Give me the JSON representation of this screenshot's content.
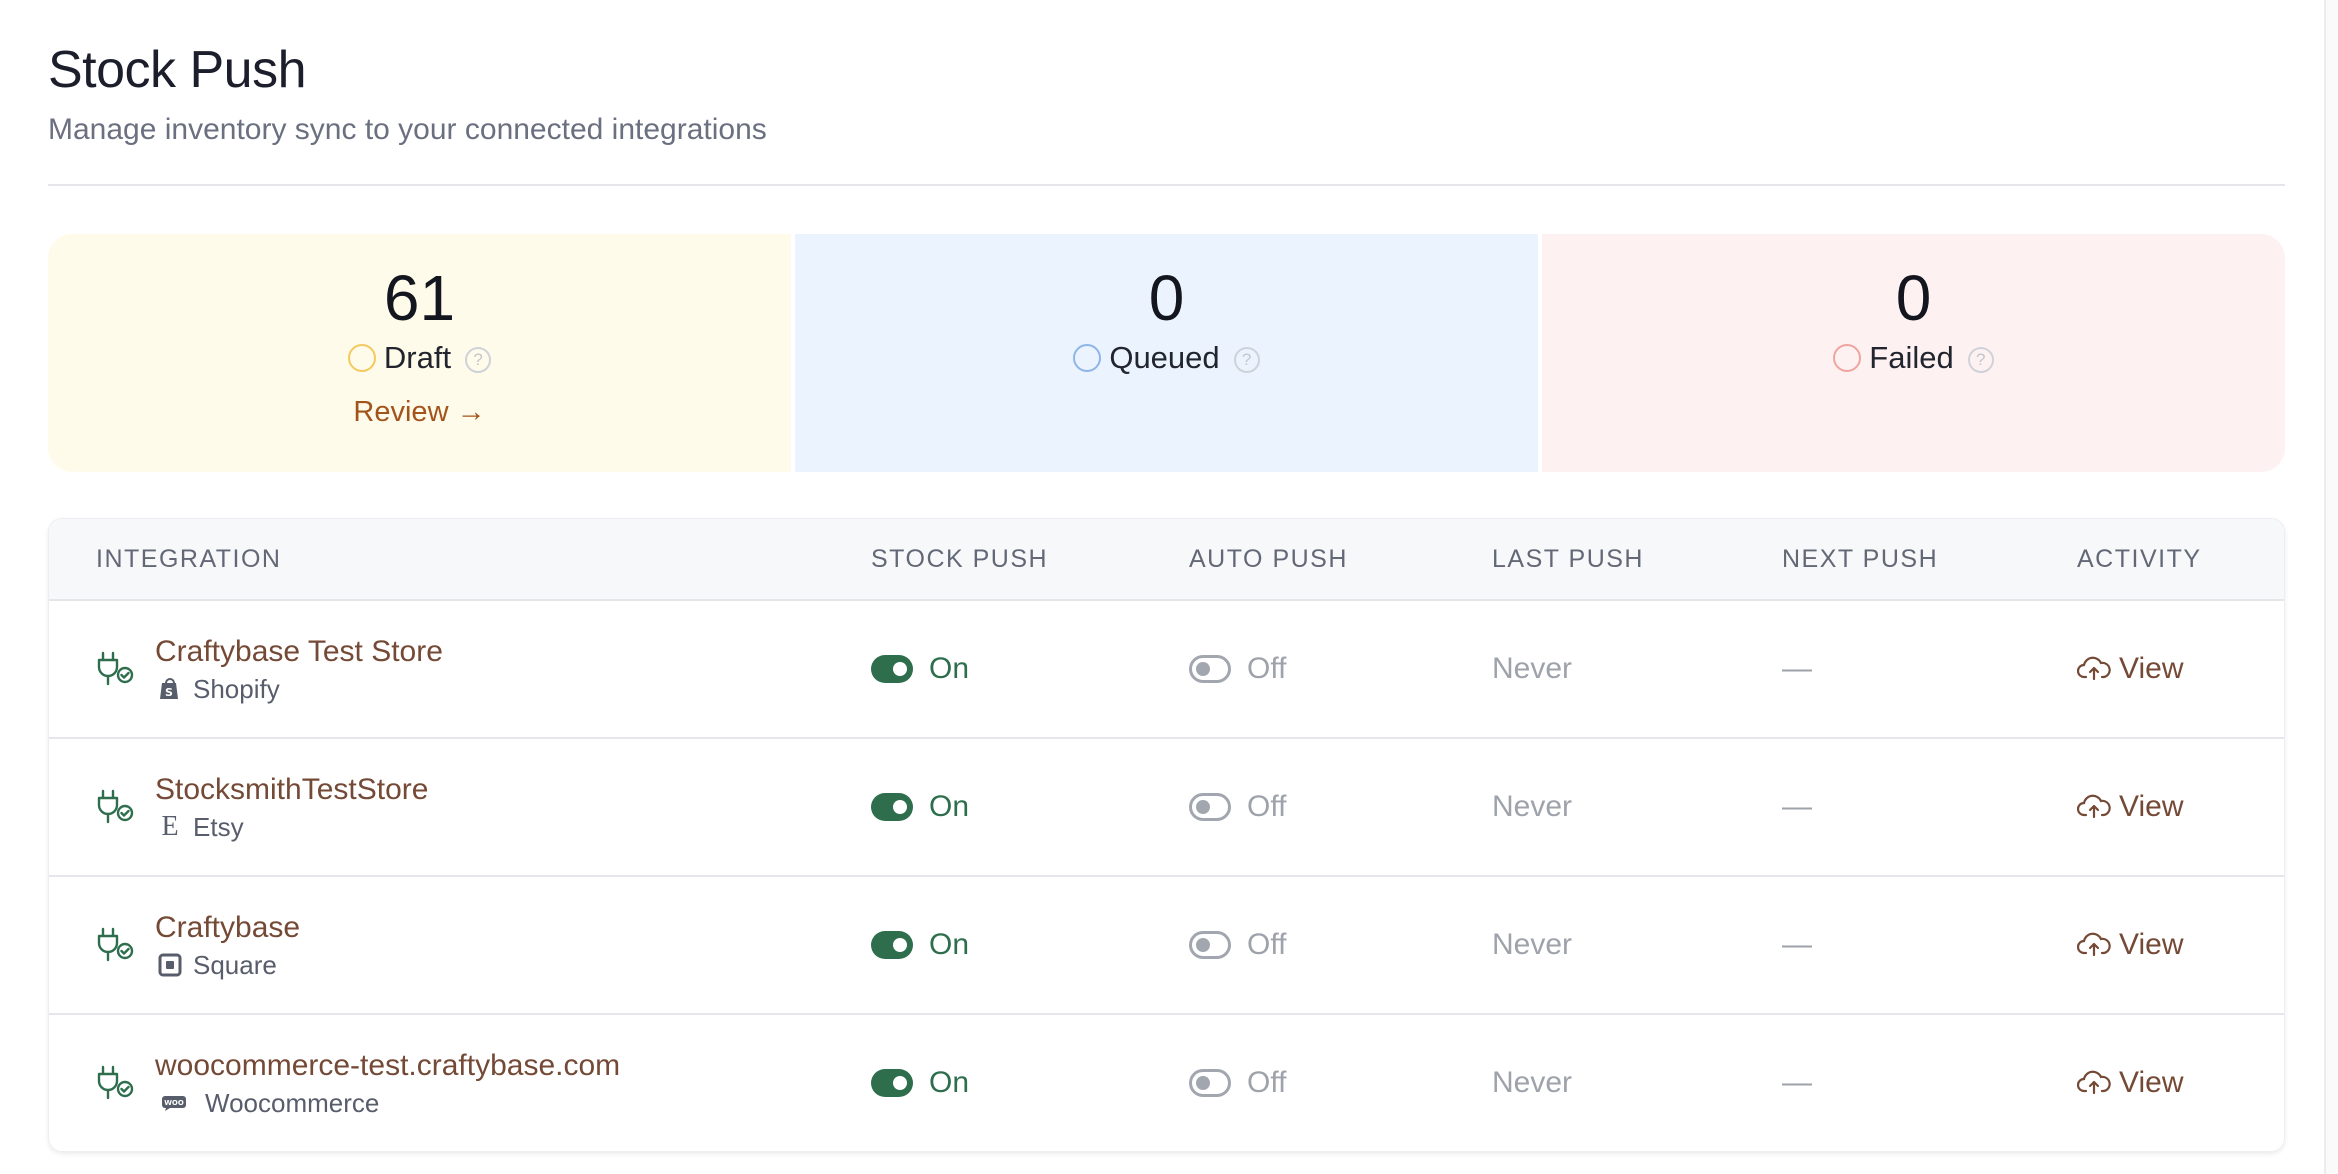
{
  "header": {
    "title": "Stock Push",
    "subtitle": "Manage inventory sync to your connected integrations"
  },
  "stats": {
    "draft": {
      "value": "61",
      "label": "Draft",
      "help": "?",
      "link": "Review →",
      "ring_color": "#f4c95d"
    },
    "queued": {
      "value": "0",
      "label": "Queued",
      "help": "?",
      "ring_color": "#8fb5e8"
    },
    "failed": {
      "value": "0",
      "label": "Failed",
      "help": "?",
      "ring_color": "#f0a4a0"
    }
  },
  "table": {
    "columns": [
      "INTEGRATION",
      "STOCK PUSH",
      "AUTO PUSH",
      "LAST PUSH",
      "NEXT PUSH",
      "ACTIVITY"
    ],
    "rows": [
      {
        "name": "Craftybase Test Store",
        "platform": "Shopify",
        "platform_icon": "shopify-icon",
        "stock_push": "On",
        "auto_push": "Off",
        "last_push": "Never",
        "next_push": "—",
        "activity": "View"
      },
      {
        "name": "StocksmithTestStore",
        "platform": "Etsy",
        "platform_icon": "etsy-icon",
        "stock_push": "On",
        "auto_push": "Off",
        "last_push": "Never",
        "next_push": "—",
        "activity": "View"
      },
      {
        "name": "Craftybase",
        "platform": "Square",
        "platform_icon": "square-icon",
        "stock_push": "On",
        "auto_push": "Off",
        "last_push": "Never",
        "next_push": "—",
        "activity": "View"
      },
      {
        "name": "woocommerce-test.craftybase.com",
        "platform": "Woocommerce",
        "platform_icon": "woocommerce-icon",
        "stock_push": "On",
        "auto_push": "Off",
        "last_push": "Never",
        "next_push": "—",
        "activity": "View"
      }
    ]
  },
  "colors": {
    "accent_link": "#744a36",
    "toggle_on": "#2e6e4d",
    "draft_bg": "#fefbeb",
    "queued_bg": "#ebf4fe",
    "failed_bg": "#fdf2f1"
  }
}
